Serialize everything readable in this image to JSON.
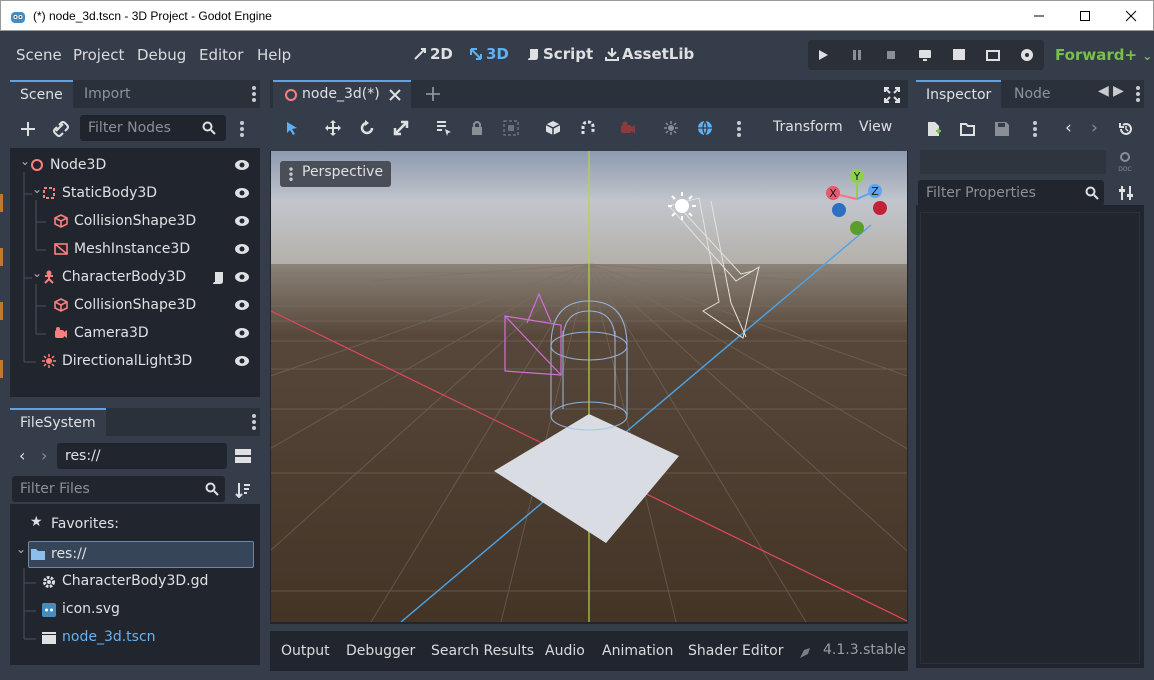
{
  "window": {
    "title": "(*) node_3d.tscn - 3D Project - Godot Engine"
  },
  "menubar": {
    "items": [
      "Scene",
      "Project",
      "Debug",
      "Editor",
      "Help"
    ]
  },
  "workspaces": [
    {
      "label": "2D"
    },
    {
      "label": "3D",
      "active": true
    },
    {
      "label": "Script"
    },
    {
      "label": "AssetLib"
    }
  ],
  "renderer": {
    "label": "Forward+"
  },
  "scene_dock": {
    "tabs": [
      "Scene",
      "Import"
    ],
    "filter_placeholder": "Filter Nodes",
    "tree": [
      {
        "label": "Node3D",
        "icon": "node3d-icon",
        "depth": 0,
        "expanded": true
      },
      {
        "label": "StaticBody3D",
        "icon": "staticbody-icon",
        "depth": 1,
        "expanded": true
      },
      {
        "label": "CollisionShape3D",
        "icon": "collisionshape-icon",
        "depth": 2
      },
      {
        "label": "MeshInstance3D",
        "icon": "meshinstance-icon",
        "depth": 2
      },
      {
        "label": "CharacterBody3D",
        "icon": "characterbody-icon",
        "depth": 1,
        "expanded": true,
        "script": true
      },
      {
        "label": "CollisionShape3D",
        "icon": "collisionshape-icon",
        "depth": 2
      },
      {
        "label": "Camera3D",
        "icon": "camera-icon",
        "depth": 2
      },
      {
        "label": "DirectionalLight3D",
        "icon": "light-icon",
        "depth": 1
      }
    ]
  },
  "filesystem": {
    "tab": "FileSystem",
    "path": "res://",
    "filter_placeholder": "Filter Files",
    "favorites": "Favorites:",
    "root": "res://",
    "files": [
      {
        "name": "CharacterBody3D.gd",
        "icon": "gear-icon"
      },
      {
        "name": "icon.svg",
        "icon": "image-icon"
      },
      {
        "name": "node_3d.tscn",
        "icon": "scene-icon",
        "highlight": true
      }
    ]
  },
  "editor": {
    "tab": "node_3d(*)",
    "toolbar": {
      "transform": "Transform",
      "view": "View"
    },
    "viewport_label": "Perspective",
    "gizmo": {
      "x": "X",
      "y": "Y",
      "z": "Z"
    }
  },
  "bottom_panel": {
    "tabs": [
      "Output",
      "Debugger",
      "Search Results",
      "Audio",
      "Animation",
      "Shader Editor"
    ],
    "version": "4.1.3.stable"
  },
  "inspector": {
    "tabs": [
      "Inspector",
      "Node"
    ],
    "filter_placeholder": "Filter Properties"
  },
  "colors": {
    "accent": "#5da3e8",
    "bg": "#363d4a",
    "panel": "#21262e",
    "node_red": "#fc7f7f",
    "renderer_green": "#77c04d"
  }
}
